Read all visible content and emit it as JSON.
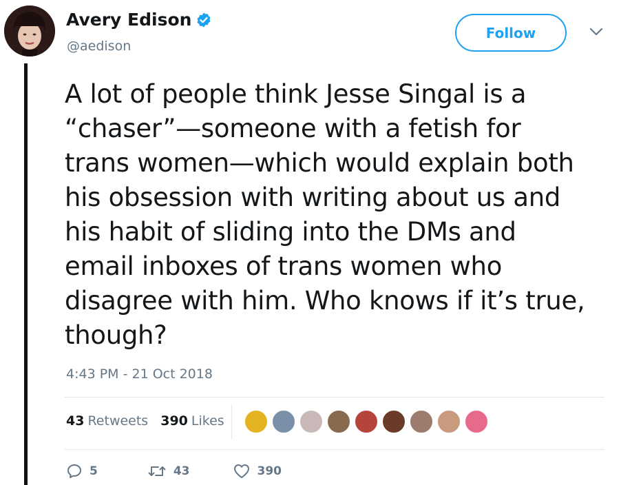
{
  "user": {
    "display_name": "Avery Edison",
    "handle": "@aedison",
    "verified": true
  },
  "follow_button": {
    "label": "Follow"
  },
  "tweet": {
    "text": "A lot of people think Jesse Singal is a\n“chaser”—someone with a fetish for\ntrans women—which would explain both\nhis obsession with writing about us and\nhis habit of sliding into the DMs and\nemail inboxes of trans women who\ndisagree with him. Who knows if it’s true,\nthough?",
    "timestamp": "4:43 PM - 21 Oct 2018"
  },
  "stats": {
    "retweets_count": "43",
    "retweets_label": "Retweets",
    "likes_count": "390",
    "likes_label": "Likes"
  },
  "likers": [
    {
      "icon": "liker-avatar-1",
      "color": "#e3b321"
    },
    {
      "icon": "liker-avatar-2",
      "color": "#7c8fa8"
    },
    {
      "icon": "liker-avatar-3",
      "color": "#c9b9b8"
    },
    {
      "icon": "liker-avatar-4",
      "color": "#8a6a4f"
    },
    {
      "icon": "liker-avatar-5",
      "color": "#b5453a"
    },
    {
      "icon": "liker-avatar-6",
      "color": "#6b3b2a"
    },
    {
      "icon": "liker-avatar-7",
      "color": "#9c7c6e"
    },
    {
      "icon": "liker-avatar-8",
      "color": "#c89a7e"
    },
    {
      "icon": "liker-avatar-9",
      "color": "#e86a8a"
    }
  ],
  "actions": {
    "reply_count": "5",
    "retweet_count": "43",
    "like_count": "390"
  },
  "colors": {
    "accent": "#1da1f2",
    "muted": "#657786",
    "text": "#14171a"
  }
}
